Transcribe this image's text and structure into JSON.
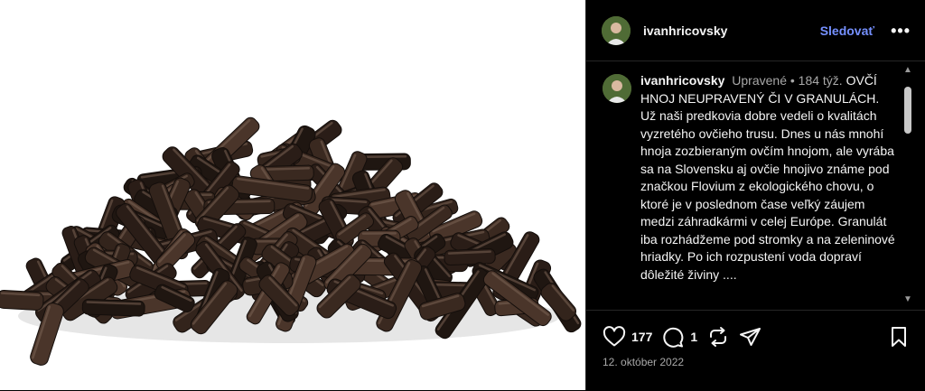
{
  "post": {
    "username": "ivanhricovsky",
    "follow_label": "Sledovať",
    "more_label": "•••",
    "image_alt": "Ovčie hnojivo v granulách"
  },
  "caption": {
    "username": "ivanhricovsky",
    "edited_label": "Upravené",
    "separator": "•",
    "time_ago": "184 týž.",
    "text": "OVČÍ HNOJ NEUPRAVENÝ ČI V GRANULÁCH. Už naši predkovia dobre vedeli o kvalitách vyzretého ovčieho trusu. Dnes u nás mnohí hnoja zozbieraným ovčím hnojom, ale vyrába sa na Slovensku aj ovčie hnojivo známe pod značkou Flovium z ekologického chovu, o ktoré je v poslednom čase veľký záujem medzi záhradkármi v celej Európe. Granulát iba rozhádžeme pod stromky a na zeleninové hriadky. Po ich rozpustení voda dopraví dôležité živiny ...."
  },
  "actions": {
    "like_count": "177",
    "comment_count": "1",
    "icons": [
      "heart-icon",
      "comment-icon",
      "repost-icon",
      "share-icon",
      "bookmark-icon"
    ]
  },
  "date": "12. október 2022",
  "colors": {
    "background": "#000000",
    "accent": "#7590ff",
    "muted": "#a8a8a8"
  }
}
